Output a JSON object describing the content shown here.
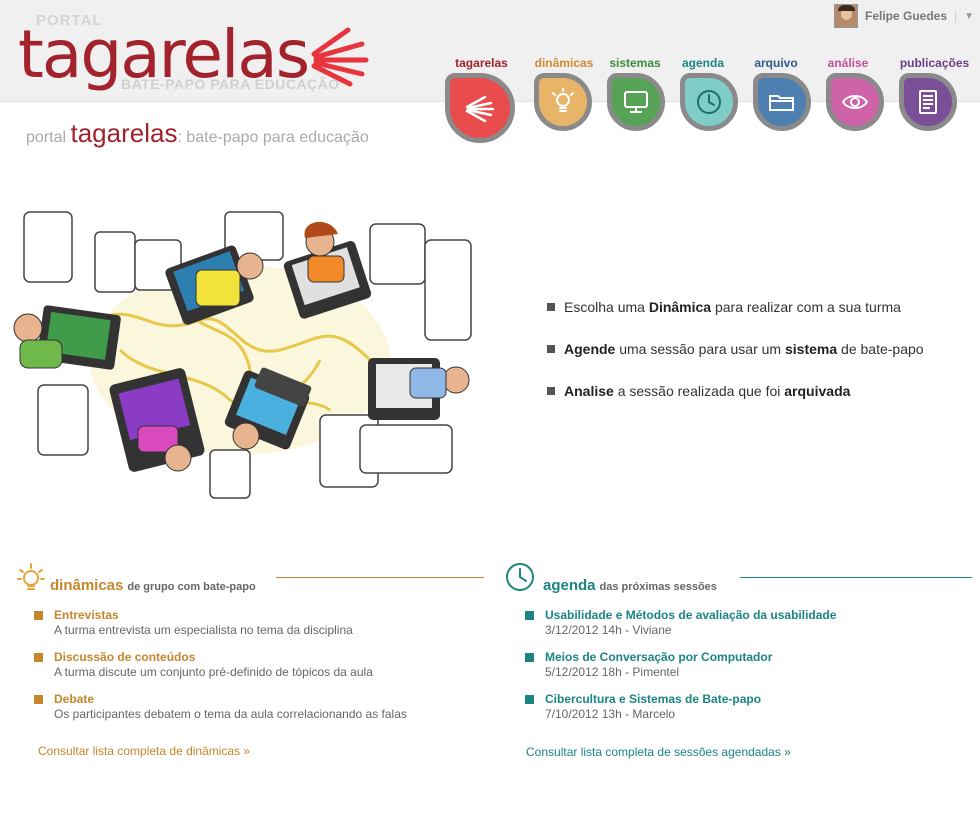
{
  "logo": {
    "portal": "PORTAL",
    "word": "tagarelas",
    "tagline": "BATE-PAPO PARA EDUCAÇÃO"
  },
  "user": {
    "name": "Felipe Guedes",
    "separator": "|",
    "menu_glyph": "▼"
  },
  "nav": [
    {
      "label": "tagarelas",
      "color": "#a3232d",
      "bg": "#e84c4c",
      "icon": "tagarelas-rays-icon"
    },
    {
      "label": "dinâmicas",
      "color": "#d08a2f",
      "bg": "#e8b568",
      "icon": "lightbulb-icon"
    },
    {
      "label": "sistemas",
      "color": "#3d8a3d",
      "bg": "#56a356",
      "icon": "monitor-icon"
    },
    {
      "label": "agenda",
      "color": "#1a8583",
      "bg": "#7fcdc6",
      "icon": "clock-icon"
    },
    {
      "label": "arquivo",
      "color": "#2e5b8a",
      "bg": "#4d7fb0",
      "icon": "folder-icon"
    },
    {
      "label": "análise",
      "color": "#c4509a",
      "bg": "#cf63a8",
      "icon": "eye-icon"
    },
    {
      "label": "publicações",
      "color": "#6b3f85",
      "bg": "#7b4f97",
      "icon": "document-icon"
    }
  ],
  "tagline": {
    "pre": "portal",
    "brand": "tagarelas",
    "post": ": bate-papo para educação"
  },
  "bullets": [
    {
      "a": "Escolha uma ",
      "b": "Dinâmica",
      "c": " para realizar com a sua turma",
      "d": "",
      "e": ""
    },
    {
      "a": "",
      "b": "Agende",
      "c": " uma sessão para usar um ",
      "d": "sistema",
      "e": " de bate-papo"
    },
    {
      "a": "",
      "b": "Analise",
      "c": " a sessão realizada que foi ",
      "d": "arquivada",
      "e": ""
    }
  ],
  "dinamicas": {
    "title": "dinâmicas",
    "subtitle": "de grupo com bate-papo",
    "color": "#c6862c",
    "items": [
      {
        "title": "Entrevistas",
        "desc": "A turma entrevista um especialista no tema da disciplina"
      },
      {
        "title": "Discussão de conteúdos",
        "desc": "A turma discute um conjunto pré-definido de tópicos da aula"
      },
      {
        "title": "Debate",
        "desc": "Os participantes debatem o tema da aula correlacionando as falas"
      }
    ],
    "more": "Consultar lista completa de dinâmicas »"
  },
  "agenda": {
    "title": "agenda",
    "subtitle": "das próximas sessões",
    "color": "#1a8583",
    "items": [
      {
        "title": "Usabilidade e Métodos de avaliação da usabilidade",
        "desc": "3/12/2012 14h - Viviane"
      },
      {
        "title": "Meios de Conversação por Computador",
        "desc": "5/12/2012 18h - Pimentel"
      },
      {
        "title": "Cibercultura e Sistemas de Bate-papo",
        "desc": "7/10/2012 13h - Marcelo"
      }
    ],
    "more": "Consultar lista completa de sessões agendadas »"
  }
}
